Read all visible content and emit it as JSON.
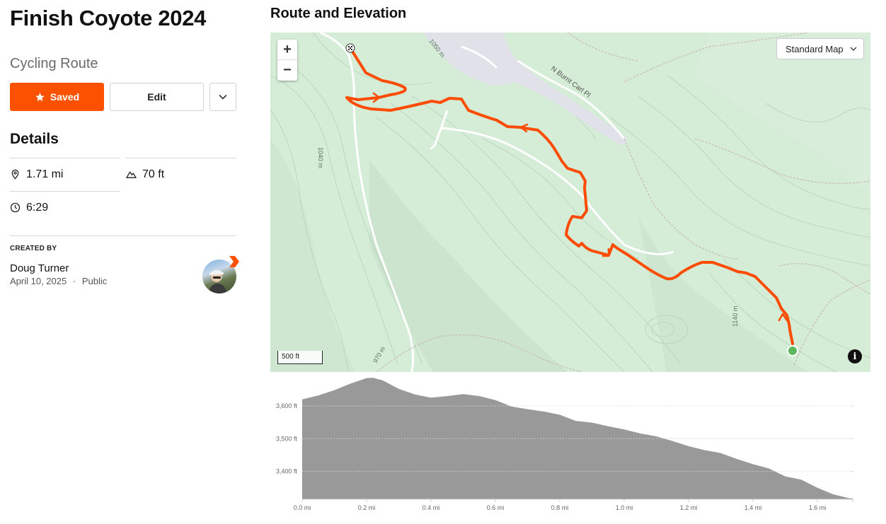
{
  "route": {
    "title": "Finish Coyote 2024",
    "type": "Cycling Route",
    "saved_label": "Saved",
    "edit_label": "Edit"
  },
  "details": {
    "heading": "Details",
    "distance": "1.71 mi",
    "elevation_gain": "70 ft",
    "time": "6:29"
  },
  "creator": {
    "label": "CREATED BY",
    "name": "Doug Turner",
    "date": "April 10, 2025",
    "separator": "·",
    "visibility": "Public"
  },
  "map": {
    "section_title": "Route and Elevation",
    "map_type": "Standard Map",
    "zoom_in": "+",
    "zoom_out": "−",
    "scale_label": "500 ft",
    "info_label": "i",
    "street_label": "N Burnt Carl Pl",
    "contour_labels": [
      "1050 m",
      "1040 m",
      "970 m",
      "1140 m"
    ],
    "route_color": "#fc4c02",
    "start_color": "#5cb85c"
  },
  "chart_data": {
    "type": "area",
    "title": "",
    "xlabel": "",
    "ylabel": "",
    "x_ticks": [
      "0.0 mi",
      "0.2 mi",
      "0.4 mi",
      "0.6 mi",
      "0.8 mi",
      "1.0 mi",
      "1.2 mi",
      "1.4 mi",
      "1.6 mi"
    ],
    "y_ticks": [
      "3,400 ft",
      "3,500 ft",
      "3,600 ft"
    ],
    "xlim": [
      0,
      1.71
    ],
    "ylim": [
      3315,
      3695
    ],
    "grid": true,
    "color": "#999999",
    "x": [
      0,
      0.05,
      0.1,
      0.15,
      0.2,
      0.22,
      0.25,
      0.3,
      0.35,
      0.4,
      0.45,
      0.5,
      0.55,
      0.6,
      0.65,
      0.7,
      0.75,
      0.8,
      0.85,
      0.9,
      0.95,
      1.0,
      1.05,
      1.1,
      1.15,
      1.2,
      1.25,
      1.3,
      1.35,
      1.4,
      1.45,
      1.5,
      1.55,
      1.6,
      1.65,
      1.7,
      1.71
    ],
    "y": [
      3620,
      3632,
      3648,
      3668,
      3685,
      3686,
      3678,
      3652,
      3635,
      3625,
      3630,
      3636,
      3630,
      3618,
      3598,
      3590,
      3583,
      3573,
      3554,
      3549,
      3538,
      3528,
      3516,
      3507,
      3493,
      3477,
      3465,
      3456,
      3438,
      3422,
      3409,
      3385,
      3375,
      3350,
      3330,
      3318,
      3318
    ]
  }
}
